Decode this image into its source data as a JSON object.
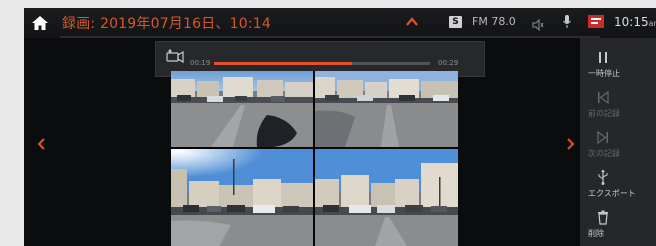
{
  "status_bar": {
    "title": "録画: 2019年07月16日、10:14",
    "source_badge": "S",
    "radio": "FM 78.0",
    "clock": "10:15",
    "clock_suffix": "am",
    "accent_color": "#d8572a"
  },
  "playback": {
    "time_start": "00:19",
    "time_end": "00:29",
    "progress_fraction": 0.64,
    "bar_color": "#e0532a"
  },
  "side_panel": {
    "items": [
      {
        "icon": "pause-icon",
        "label": "一時停止",
        "enabled": true
      },
      {
        "icon": "skip-previous-icon",
        "label": "前の記録",
        "enabled": false
      },
      {
        "icon": "skip-next-icon",
        "label": "次の記録",
        "enabled": false
      },
      {
        "icon": "usb-icon",
        "label": "エクスポート",
        "enabled": true
      },
      {
        "icon": "trash-icon",
        "label": "削除",
        "enabled": true
      }
    ]
  },
  "camera_views": [
    {
      "name": "front-camera-view",
      "icon": "camera-feed"
    },
    {
      "name": "rear-camera-view",
      "icon": "camera-feed"
    },
    {
      "name": "left-camera-view",
      "icon": "camera-feed"
    },
    {
      "name": "right-camera-view",
      "icon": "camera-feed"
    }
  ]
}
